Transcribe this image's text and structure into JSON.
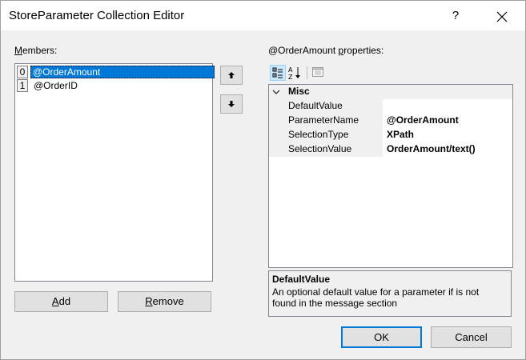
{
  "window": {
    "title": "StoreParameter Collection Editor",
    "help_glyph": "?"
  },
  "members": {
    "label_underlined": "M",
    "label_rest": "embers:",
    "items": [
      {
        "index": "0",
        "name": "@OrderAmount",
        "selected": true
      },
      {
        "index": "1",
        "name": "@OrderID",
        "selected": false
      }
    ]
  },
  "move": {
    "up_icon": "arrow-up-icon",
    "down_icon": "arrow-down-icon"
  },
  "actions": {
    "add_underlined": "A",
    "add_rest": "dd",
    "remove_underlined": "R",
    "remove_rest": "emove"
  },
  "properties": {
    "header_prefix": "@OrderAmount ",
    "header_underlined": "p",
    "header_suffix": "roperties:",
    "category": "Misc",
    "rows": [
      {
        "name": "DefaultValue",
        "value": ""
      },
      {
        "name": "ParameterName",
        "value": "@OrderAmount"
      },
      {
        "name": "SelectionType",
        "value": "XPath"
      },
      {
        "name": "SelectionValue",
        "value": "OrderAmount/text()"
      }
    ],
    "toolbar_icons": [
      "categorized-icon",
      "alphabetical-icon",
      "property-pages-icon"
    ]
  },
  "description": {
    "title": "DefaultValue",
    "text": "An optional default value for a parameter if is not found in the message section"
  },
  "footer": {
    "ok_label": "OK",
    "cancel_label": "Cancel"
  },
  "colors": {
    "selection": "#0078d7",
    "button_face": "#e1e1e1",
    "window_bg": "#f0f0f0"
  }
}
